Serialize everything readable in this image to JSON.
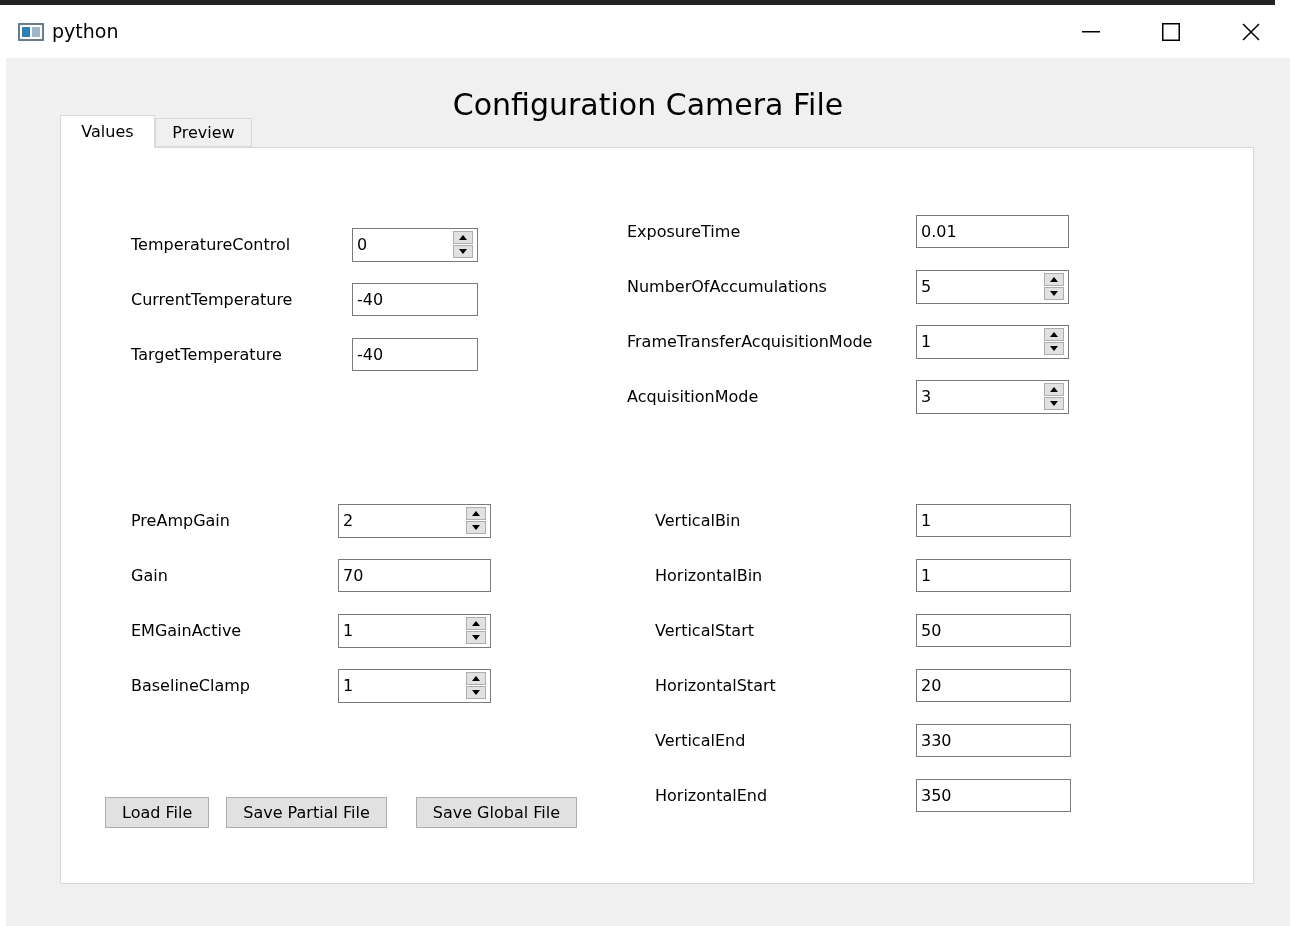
{
  "window": {
    "title": "python"
  },
  "heading": "Configuration Camera File",
  "tabs": [
    {
      "label": "Values",
      "selected": true
    },
    {
      "label": "Preview",
      "selected": false
    }
  ],
  "groups": [
    {
      "fields": [
        {
          "label": "TemperatureControl",
          "kind": "spin",
          "value": "0"
        },
        {
          "label": "CurrentTemperature",
          "kind": "text",
          "value": "-40"
        },
        {
          "label": "TargetTemperature",
          "kind": "text",
          "value": "-40"
        }
      ]
    },
    {
      "fields": [
        {
          "label": "ExposureTime",
          "kind": "text",
          "value": "0.01"
        },
        {
          "label": "NumberOfAccumulations",
          "kind": "spin",
          "value": "5"
        },
        {
          "label": "FrameTransferAcquisitionMode",
          "kind": "spin",
          "value": "1"
        },
        {
          "label": "AcquisitionMode",
          "kind": "spin",
          "value": "3"
        }
      ]
    },
    {
      "fields": [
        {
          "label": "PreAmpGain",
          "kind": "spin",
          "value": "2"
        },
        {
          "label": "Gain",
          "kind": "text",
          "value": "70"
        },
        {
          "label": "EMGainActive",
          "kind": "spin",
          "value": "1"
        },
        {
          "label": "BaselineClamp",
          "kind": "spin",
          "value": "1"
        }
      ]
    },
    {
      "fields": [
        {
          "label": "VerticalBin",
          "kind": "text",
          "value": "1"
        },
        {
          "label": "HorizontalBin",
          "kind": "text",
          "value": "1"
        },
        {
          "label": "VerticalStart",
          "kind": "text",
          "value": "50"
        },
        {
          "label": "HorizontalStart",
          "kind": "text",
          "value": "20"
        },
        {
          "label": "VerticalEnd",
          "kind": "text",
          "value": "330"
        },
        {
          "label": "HorizontalEnd",
          "kind": "text",
          "value": "350"
        }
      ]
    }
  ],
  "buttons": [
    "Load File",
    "Save Partial File",
    "Save Global File"
  ]
}
